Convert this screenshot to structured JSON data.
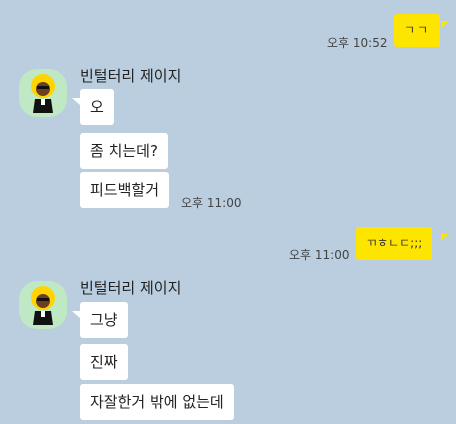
{
  "messages": {
    "m1": {
      "text": "ㄱㄱ",
      "time": "오후 10:52"
    },
    "group1": {
      "sender": "빈털터리 제이지",
      "lines": [
        "오",
        "좀 치는데?",
        "피드백할거"
      ],
      "time": "오후 11:00"
    },
    "m2": {
      "text": "ㄲㅎㄴㄷ;;;",
      "time": "오후 11:00"
    },
    "group2": {
      "sender": "빈털터리 제이지",
      "lines": [
        "그냥",
        "진짜",
        "자잘한거 밖에 없는데"
      ]
    }
  },
  "colors": {
    "background": "#bacee0",
    "my_bubble": "#fee500",
    "their_bubble": "#ffffff",
    "avatar_bg": "#bfe8c4"
  },
  "icons": {
    "avatar": "character-with-afro-avatar-icon"
  }
}
